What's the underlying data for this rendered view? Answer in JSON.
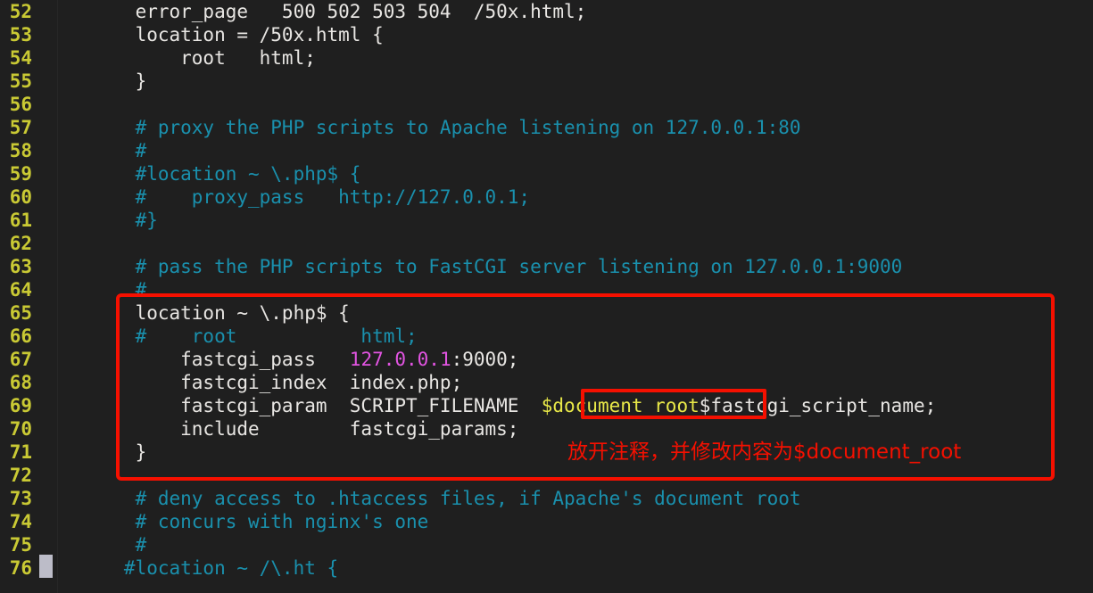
{
  "app": {
    "kind": "terminal-text-editor",
    "file_context": "nginx configuration (nginx.conf)"
  },
  "theme": {
    "background": "#1f1f1f",
    "default_text": "#e8e6e3",
    "line_number": "#c9c934",
    "comment": "#1a90ad",
    "number_literal": "#e254e2",
    "highlight_text": "#e8e848",
    "annotation": "#f51000",
    "cursor": "#bcbcc8"
  },
  "editor": {
    "first_line_number": 52,
    "cursor_line": 76,
    "line_numbers": [
      52,
      53,
      54,
      55,
      56,
      57,
      58,
      59,
      60,
      61,
      62,
      63,
      64,
      65,
      66,
      67,
      68,
      69,
      70,
      71,
      72,
      73,
      74,
      75,
      76
    ],
    "lines": [
      {
        "n": 52,
        "segments": [
          {
            "t": "    error_page   500 502 503 504  /50x.html;",
            "c": "plain"
          }
        ]
      },
      {
        "n": 53,
        "segments": [
          {
            "t": "    location = /50x.html {",
            "c": "plain"
          }
        ]
      },
      {
        "n": 54,
        "segments": [
          {
            "t": "        root   html;",
            "c": "plain"
          }
        ]
      },
      {
        "n": 55,
        "segments": [
          {
            "t": "    }",
            "c": "plain"
          }
        ]
      },
      {
        "n": 56,
        "segments": [
          {
            "t": "",
            "c": "plain"
          }
        ]
      },
      {
        "n": 57,
        "segments": [
          {
            "t": "    # proxy the PHP scripts to Apache listening on 127.0.0.1:80",
            "c": "cmt"
          }
        ]
      },
      {
        "n": 58,
        "segments": [
          {
            "t": "    #",
            "c": "cmt"
          }
        ]
      },
      {
        "n": 59,
        "segments": [
          {
            "t": "    #location ~ \\.php$ {",
            "c": "cmt"
          }
        ]
      },
      {
        "n": 60,
        "segments": [
          {
            "t": "    #    proxy_pass   http://127.0.0.1;",
            "c": "cmt"
          }
        ]
      },
      {
        "n": 61,
        "segments": [
          {
            "t": "    #}",
            "c": "cmt"
          }
        ]
      },
      {
        "n": 62,
        "segments": [
          {
            "t": "",
            "c": "plain"
          }
        ]
      },
      {
        "n": 63,
        "segments": [
          {
            "t": "    # pass the PHP scripts to FastCGI server listening on 127.0.0.1:9000",
            "c": "cmt"
          }
        ]
      },
      {
        "n": 64,
        "segments": [
          {
            "t": "    #",
            "c": "cmt"
          }
        ]
      },
      {
        "n": 65,
        "segments": [
          {
            "t": "    location ~ \\.php$ {",
            "c": "plain"
          }
        ]
      },
      {
        "n": 66,
        "segments": [
          {
            "t": "    #    root           html;",
            "c": "cmt"
          }
        ]
      },
      {
        "n": 67,
        "segments": [
          {
            "t": "        fastcgi_pass   ",
            "c": "plain"
          },
          {
            "t": "127.0.0.1",
            "c": "num"
          },
          {
            "t": ":9000;",
            "c": "plain"
          }
        ]
      },
      {
        "n": 68,
        "segments": [
          {
            "t": "        fastcgi_index  index.php;",
            "c": "plain"
          }
        ]
      },
      {
        "n": 69,
        "segments": [
          {
            "t": "        fastcgi_param  SCRIPT_FILENAME  ",
            "c": "plain"
          },
          {
            "t": "$document_root",
            "c": "hl"
          },
          {
            "t": "$fastcgi_script_name;",
            "c": "plain"
          }
        ]
      },
      {
        "n": 70,
        "segments": [
          {
            "t": "        include        fastcgi_params;",
            "c": "plain"
          }
        ]
      },
      {
        "n": 71,
        "segments": [
          {
            "t": "    }",
            "c": "plain"
          }
        ]
      },
      {
        "n": 72,
        "segments": [
          {
            "t": "",
            "c": "plain"
          }
        ]
      },
      {
        "n": 73,
        "segments": [
          {
            "t": "    # deny access to .htaccess files, if Apache's document root",
            "c": "cmt"
          }
        ]
      },
      {
        "n": 74,
        "segments": [
          {
            "t": "    # concurs with nginx's one",
            "c": "cmt"
          }
        ]
      },
      {
        "n": 75,
        "segments": [
          {
            "t": "    #",
            "c": "cmt"
          }
        ]
      },
      {
        "n": 76,
        "segments": [
          {
            "t": "   #location ~ /\\.ht {",
            "c": "cmt"
          }
        ]
      }
    ]
  },
  "annotations": {
    "block_highlight": {
      "label": "php location block outline",
      "covers_lines": "65-71"
    },
    "token_highlight": {
      "label": "document root variable outline",
      "token": "$document_root",
      "on_line": 69
    },
    "note": {
      "text": "放开注释，并修改内容为$document_root",
      "on_line": 71
    }
  }
}
